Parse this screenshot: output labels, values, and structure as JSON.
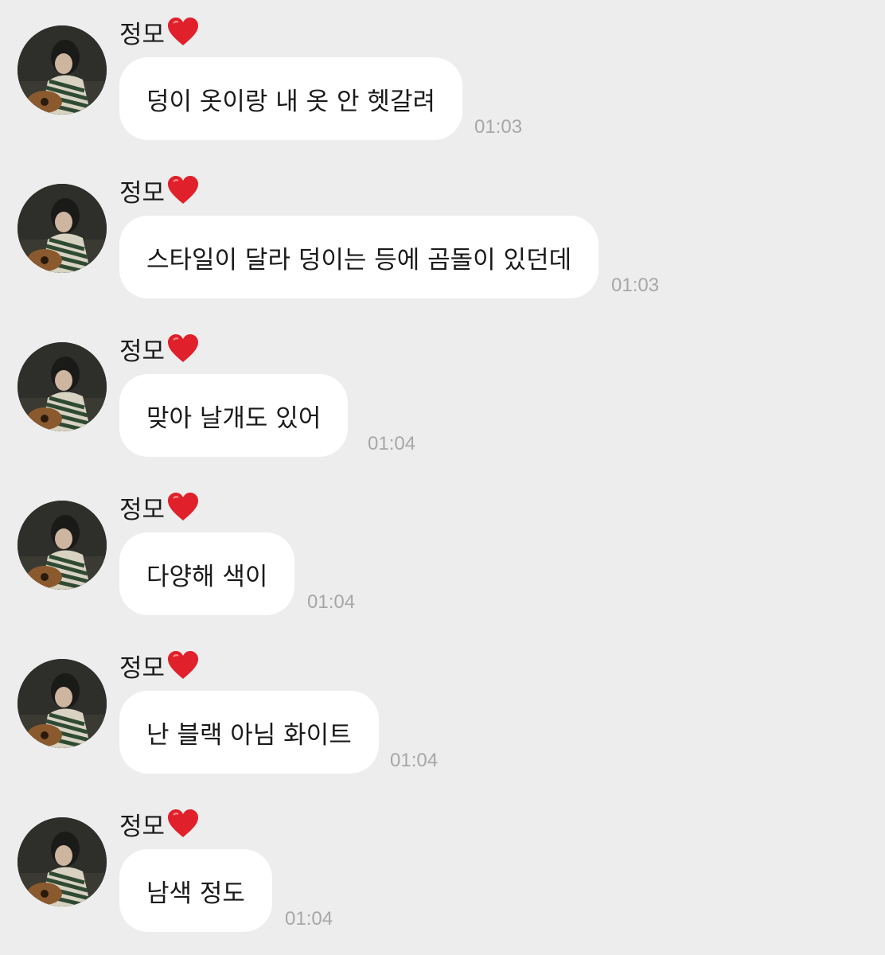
{
  "conversation": {
    "messages": [
      {
        "sender": "정모",
        "text": "덩이 옷이랑 내 옷 안 헷갈려",
        "time": "01:03"
      },
      {
        "sender": "정모",
        "text": "스타일이 달라 덩이는 등에 곰돌이 있던데",
        "time": "01:03"
      },
      {
        "sender": "정모",
        "text": "맞아 날개도 있어",
        "time": "01:04"
      },
      {
        "sender": "정모",
        "text": "다양해 색이",
        "time": "01:04"
      },
      {
        "sender": "정모",
        "text": "난 블랙 아님 화이트",
        "time": "01:04"
      },
      {
        "sender": "정모",
        "text": "남색 정도",
        "time": "01:04"
      }
    ]
  },
  "icons": {
    "heart": "red-heart-emoji"
  },
  "colors": {
    "background": "#ededed",
    "bubble": "#ffffff",
    "heart": "#e0202b",
    "timestamp": "#a7a7a7"
  }
}
